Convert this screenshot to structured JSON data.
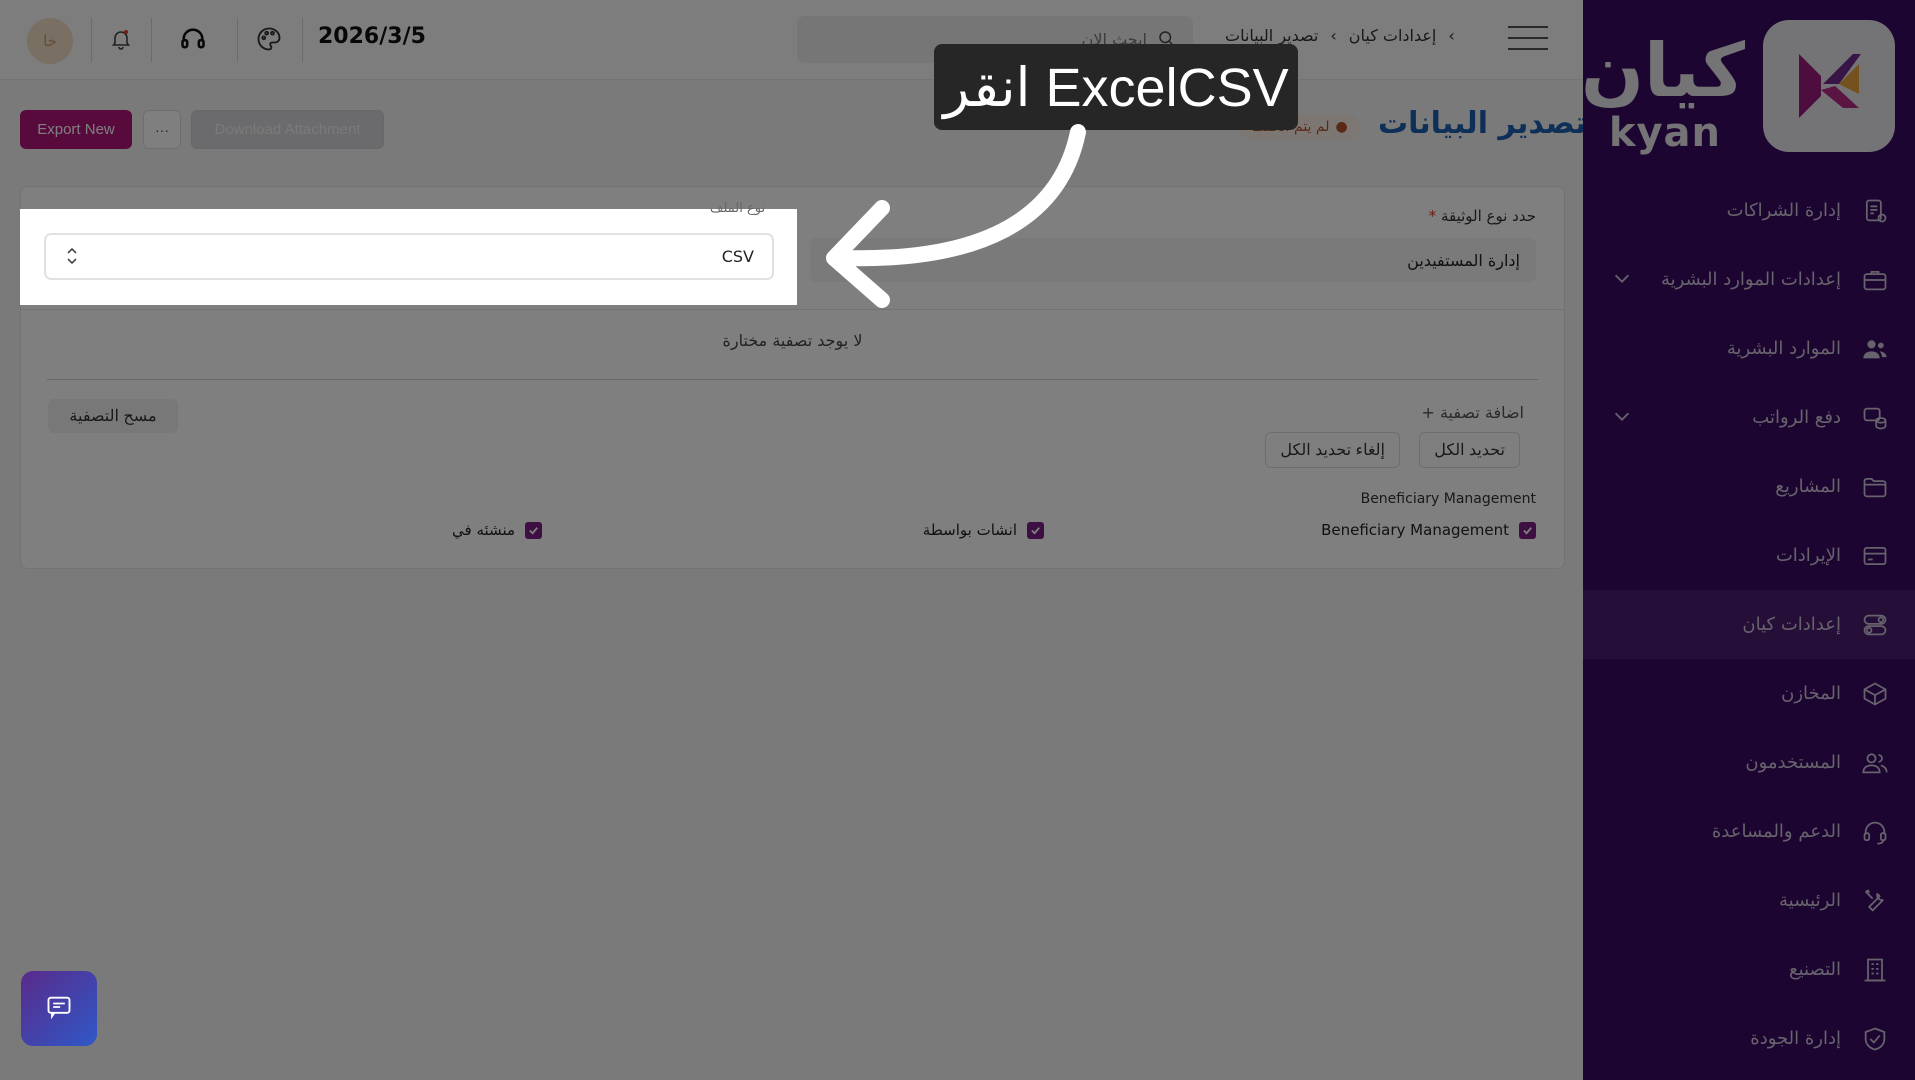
{
  "topbar": {
    "avatar": "خا",
    "date": "2026/3/5",
    "search_placeholder": "ابحث الان",
    "breadcrumb": [
      "إعدادات كيان",
      "تصدير البيانات"
    ]
  },
  "sidebar": {
    "logo_ar": "كيان",
    "logo_en": "kyan",
    "items": [
      {
        "label": "إدارة الشراكات",
        "icon": "document-icon"
      },
      {
        "label": "إعدادات الموارد البشرية",
        "icon": "briefcase-icon",
        "expandable": true
      },
      {
        "label": "الموارد البشرية",
        "icon": "users-icon"
      },
      {
        "label": "دفع الرواتب",
        "icon": "coins-icon",
        "expandable": true
      },
      {
        "label": "المشاريع",
        "icon": "folder-icon"
      },
      {
        "label": "الإيرادات",
        "icon": "card-icon"
      },
      {
        "label": "إعدادات كيان",
        "icon": "toggle-icon",
        "active": true
      },
      {
        "label": "المخازن",
        "icon": "box-icon"
      },
      {
        "label": "المستخدمون",
        "icon": "user-group-icon"
      },
      {
        "label": "الدعم والمساعدة",
        "icon": "headset-icon"
      },
      {
        "label": "الرئيسية",
        "icon": "tools-icon"
      },
      {
        "label": "التصنيع",
        "icon": "building-icon"
      },
      {
        "label": "إدارة الجودة",
        "icon": "shield-check-icon"
      }
    ]
  },
  "page": {
    "title": "تصدير البيانات",
    "status": "لم يتم الحفظ",
    "export_button": "Export New",
    "more_button": "···",
    "download_button": "Download Attachment"
  },
  "form": {
    "doctype_label": "حدد نوع الوثيقة",
    "doctype_value": "إدارة المستفيدين",
    "format_label": "نوع الملف",
    "format_value": "CSV",
    "no_filter": "لا يوجد تصفية مختارة",
    "clear_filter": "مسح التصفية",
    "add_filter": "+ اضافة تصفية",
    "select_all": "تحديد الكل",
    "deselect_all": "إلغاء تحديد الكل",
    "group_label": "Beneficiary Management",
    "fields": [
      {
        "label": "Beneficiary Management",
        "checked": true
      },
      {
        "label": "انشات بواسطة",
        "checked": true
      },
      {
        "label": "منشئه في",
        "checked": true
      }
    ]
  },
  "tooltip": {
    "text": "انقر ExcelCSV"
  },
  "colors": {
    "sidebar_bg": "#3a0a63",
    "accent": "#b0147a",
    "title_blue": "#1d5fb0",
    "checkbox": "#7b1f86"
  }
}
